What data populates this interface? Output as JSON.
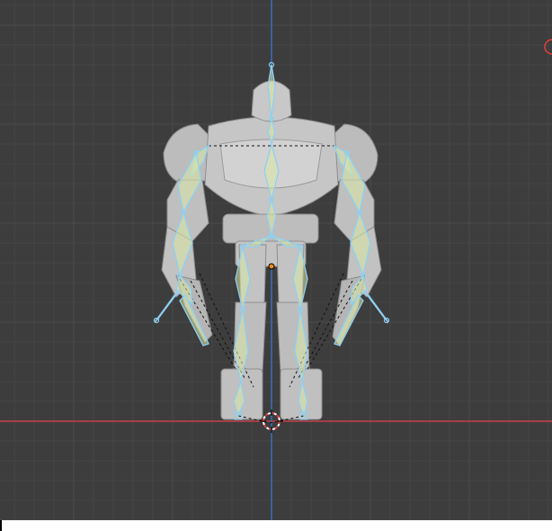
{
  "viewport": {
    "background": "#3d3d3d",
    "grid_minor_color": "#454545",
    "grid_major_color": "#4c4c4c",
    "x_axis_color": "#c4404d",
    "z_axis_color": "#3a6fb8"
  },
  "scene": {
    "object": "robot-mesh",
    "armature": "skeleton",
    "mesh_color": "#c9c9c9",
    "mesh_shadow": "#8e8e8e",
    "bone_color": "#8fd0f0",
    "bone_fill": "#d8e7a6",
    "relation_line": "#111111",
    "origin_marker_color": "#f08a24",
    "cursor_3d_colors": [
      "#e04040",
      "#ffffff"
    ]
  }
}
